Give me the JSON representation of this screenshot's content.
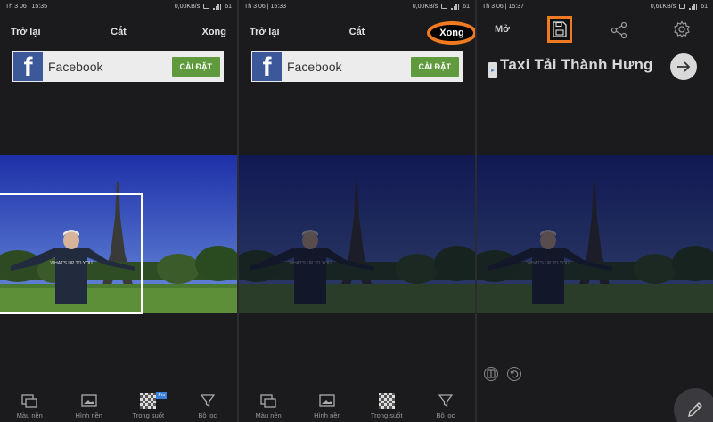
{
  "status_bars": [
    {
      "time": "Th 3 06 | 15:35",
      "speed": "0,00KB/s",
      "battery": "61"
    },
    {
      "time": "Th 3 06 | 15:33",
      "speed": "0,00KB/s",
      "battery": "61"
    },
    {
      "time": "Th 3 06 | 15:37",
      "speed": "0,61KB/s",
      "battery": "61"
    }
  ],
  "panel1": {
    "back_label": "Trở lại",
    "title": "Cắt",
    "done_label": "Xong",
    "ad": {
      "title": "Facebook",
      "button": "CÀI ĐẶT"
    }
  },
  "panel2": {
    "back_label": "Trở lại",
    "title": "Cắt",
    "done_label": "Xong",
    "ad": {
      "title": "Facebook",
      "button": "CÀI ĐẶT"
    }
  },
  "panel3": {
    "open_label": "Mở",
    "ad_title": "Taxi Tải Thành Hưng"
  },
  "toolbar": {
    "items": [
      {
        "label": "Màu nền",
        "icon": "background-color-icon"
      },
      {
        "label": "Hình nền",
        "icon": "wallpaper-icon"
      },
      {
        "label": "Trong suốt",
        "icon": "transparent-icon",
        "badge": "Pro"
      },
      {
        "label": "Bộ lọc",
        "icon": "filter-icon"
      }
    ]
  },
  "photo_text": {
    "shirt": "WHAT'S UP TO YOU"
  },
  "colors": {
    "accent_highlight": "#f07a21",
    "ad_button": "#5f9a3d",
    "facebook": "#3b5998"
  }
}
